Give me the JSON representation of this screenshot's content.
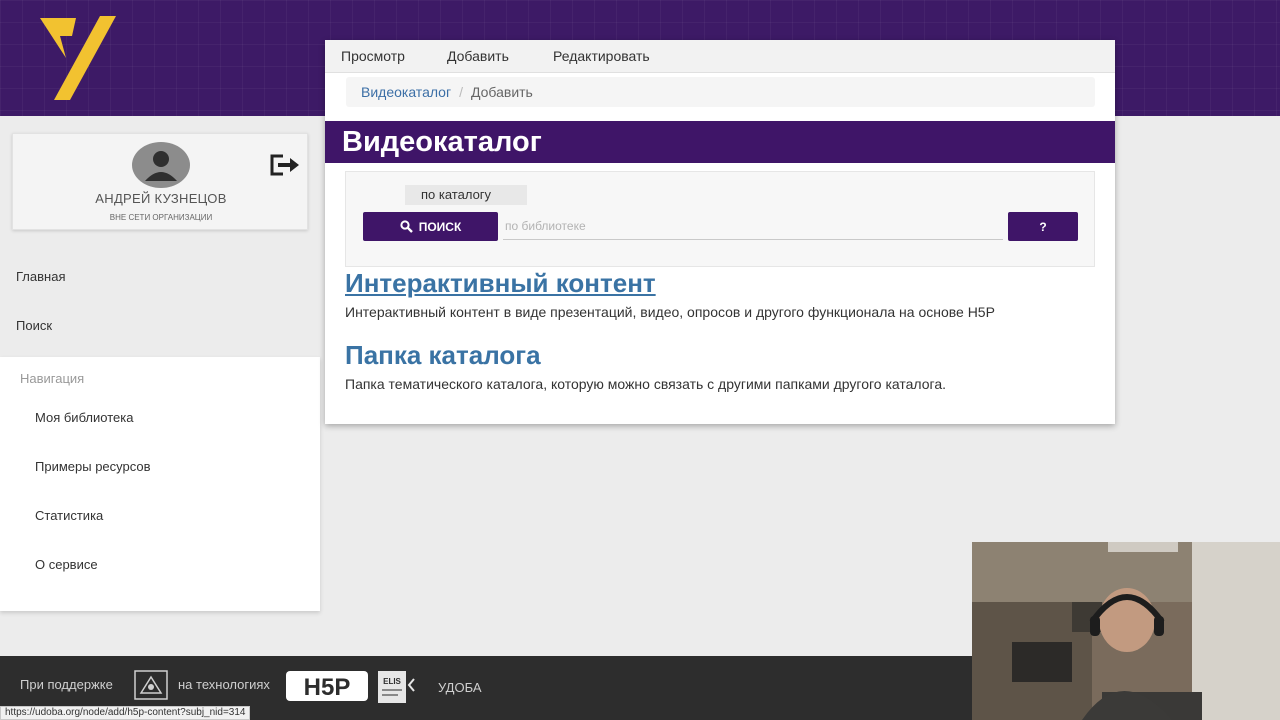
{
  "tabs": [
    "Просмотр",
    "Добавить",
    "Редактировать"
  ],
  "breadcrumb": {
    "parent": "Видеокаталог",
    "separator": "/",
    "current": "Добавить"
  },
  "page_title": "Видеокаталог",
  "profile": {
    "name": "АНДРЕЙ КУЗНЕЦОВ",
    "status": "ВНЕ СЕТИ ОРГАНИЗАЦИИ"
  },
  "sidebar": {
    "links": [
      "Главная",
      "Поиск"
    ],
    "nav_header": "Навигация",
    "nav_items": [
      "Моя библиотека",
      "Примеры ресурсов",
      "Статистика",
      "О сервисе"
    ]
  },
  "search": {
    "scope": "по каталогу",
    "button_label": "ПОИСК",
    "placeholder": "по библиотеке",
    "value": "",
    "help_label": "?"
  },
  "content_types": [
    {
      "title": "Интерактивный контент",
      "description": "Интерактивный контент в виде презентаций, видео, опросов и другого функционала на основе H5P"
    },
    {
      "title": "Папка каталога",
      "description": "Папка тематического каталога, которую можно связать с другими папками другого каталога."
    }
  ],
  "footer": {
    "supported_by": "При поддержке",
    "technology": "на технологиях",
    "h5p_logo": "H5P",
    "elis_logo": "ELIS",
    "brand": "УДОБА"
  },
  "status_url": "https://udoba.org/node/add/h5p-content?subj_nid=314",
  "colors": {
    "brand_purple": "#3f1568",
    "link_blue": "#3a73a4",
    "footer": "#2d2d2d"
  },
  "icons": [
    "logo-icon",
    "avatar-icon",
    "logout-icon",
    "search-icon",
    "support-logo-icon",
    "h5p-logo",
    "elis-logo"
  ]
}
